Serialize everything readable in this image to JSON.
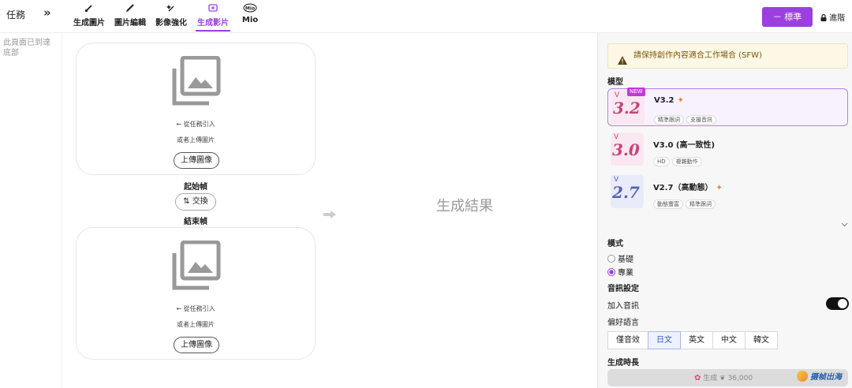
{
  "header": {
    "tasks_label": "任務",
    "collapse_glyph": "»",
    "tabs": [
      {
        "label": "生成圖片",
        "icon": "brush-icon",
        "active": false
      },
      {
        "label": "圖片編輯",
        "icon": "pencil-icon",
        "active": false
      },
      {
        "label": "影像強化",
        "icon": "sparkle-wand-icon",
        "active": false
      },
      {
        "label": "生成影片",
        "icon": "video-plus-icon",
        "active": true
      },
      {
        "label": "Mio",
        "icon": "mio-icon",
        "active": false
      }
    ],
    "standard_button": "－ 標準",
    "advanced_label": "進階"
  },
  "sidebar": {
    "note": "此頁面已到達底部"
  },
  "main": {
    "start_card": {
      "import_text": "← 從任務引入",
      "or_upload": "或者上傳圖片",
      "upload_button": "上傳圖像"
    },
    "start_frame_label": "起始幀",
    "swap_button": "⇅ 交換",
    "end_frame_label": "結束幀",
    "end_card": {
      "import_text": "← 從任務引入",
      "or_upload": "或者上傳圖片",
      "upload_button": "上傳圖像"
    },
    "result_label": "生成結果"
  },
  "panel": {
    "warning": "請保持創作內容適合工作場合 (SFW)",
    "model_section": "模型",
    "models": [
      {
        "version": "3.2",
        "title": "V3.2",
        "badge": "NEW",
        "spark": "✦",
        "tags": [
          "精準跟詞",
          "支援音訊"
        ],
        "selected": true
      },
      {
        "version": "3.0",
        "title": "V3.0 (高一致性)",
        "badge": "",
        "spark": "",
        "tags": [
          "HD",
          "複雜動作"
        ],
        "selected": false
      },
      {
        "version": "2.7",
        "title": "V2.7（高動態）",
        "badge": "",
        "spark": "✦",
        "tags": [
          "動態豐富",
          "精準跟詞"
        ],
        "selected": false
      }
    ],
    "mode_section": "模式",
    "modes": [
      {
        "label": "基礎",
        "checked": false
      },
      {
        "label": "專業",
        "checked": true
      }
    ],
    "audio_section": "音訊設定",
    "add_audio_label": "加入音訊",
    "add_audio_on": true,
    "pref_lang_label": "偏好語言",
    "languages": [
      {
        "label": "僅音效",
        "selected": false
      },
      {
        "label": "日文",
        "selected": true
      },
      {
        "label": "英文",
        "selected": false
      },
      {
        "label": "中文",
        "selected": false
      },
      {
        "label": "韓文",
        "selected": false
      }
    ],
    "duration_section": "生成時長",
    "generate_label": "生成",
    "cost": "36,000",
    "watermark": "摄帧出海"
  },
  "colors": {
    "accent": "#9b3fe0",
    "warning_bg": "#fdf7e6",
    "model_red": "#c44378",
    "model_blue": "#5463b6"
  }
}
